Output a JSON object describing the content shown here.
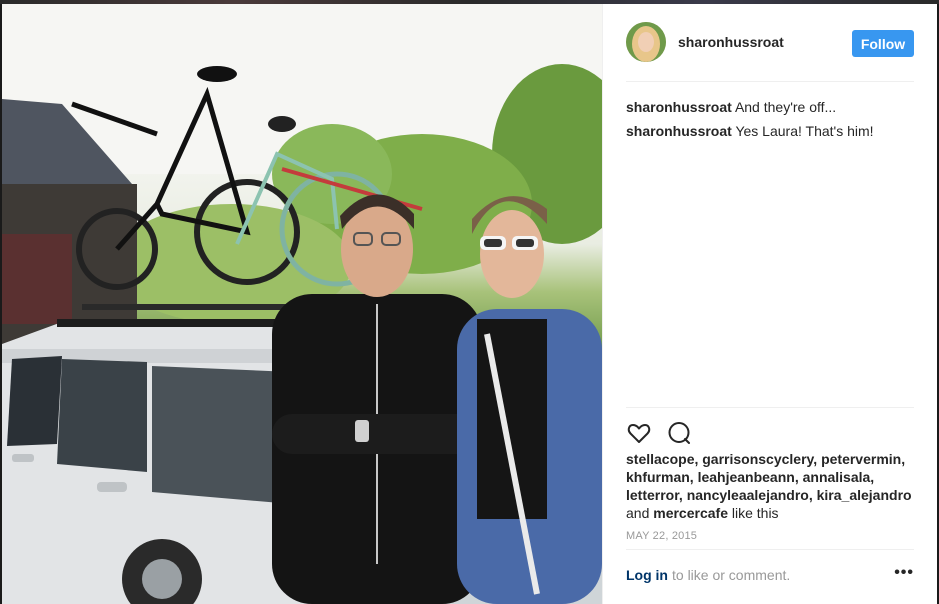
{
  "post": {
    "username": "sharonhussroat",
    "follow_label": "Follow",
    "comments": [
      {
        "author": "sharonhussroat",
        "text": "And they're off..."
      },
      {
        "author": "sharonhussroat",
        "text": "Yes Laura! That's him!"
      }
    ],
    "likes": {
      "names": "stellacope, garrisonscyclery, petervermin, khfurman, leahjeanbeann, annalisala, letterror, nancyleaalejandro, kira_alejandro",
      "and_label": "and",
      "last": "mercercafe",
      "suffix": "like this"
    },
    "date": "MAY 22, 2015",
    "login_label": "Log in",
    "login_suffix": "to like or comment.",
    "more_label": "•••"
  },
  "icons": {
    "like": "heart-icon",
    "comment": "comment-bubble-icon",
    "more": "more-options-icon"
  },
  "colors": {
    "follow_button": "#3897f0",
    "login_link": "#003569",
    "muted_text": "#999999",
    "divider": "#efefef"
  }
}
